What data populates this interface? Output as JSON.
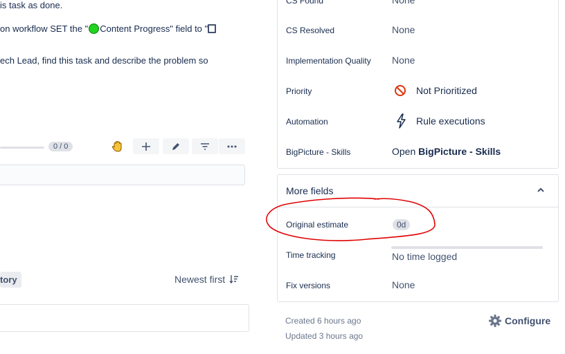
{
  "description": {
    "line1": "is task as done.",
    "line2_prefix": "on workflow SET the \"",
    "line2_suffix": "Content Progress\" field to \"",
    "line3": "ech Lead, find this task and describe the problem so"
  },
  "checklist": {
    "progress_label": "0 / 0",
    "progress_value": 0
  },
  "activity": {
    "history_tab": "tory",
    "sort_label": "Newest first"
  },
  "fields": [
    {
      "label": "CS Found",
      "value": "None"
    },
    {
      "label": "CS Resolved",
      "value": "None"
    },
    {
      "label": "Implementation Quality",
      "value": "None"
    },
    {
      "label": "Priority",
      "value": "Not Prioritized",
      "icon": "not-prioritized-icon"
    },
    {
      "label": "Automation",
      "value": "Rule executions",
      "icon": "lightning-icon"
    },
    {
      "label": "BigPicture - Skills",
      "value_prefix": "Open ",
      "value_strong": "BigPicture - Skills"
    }
  ],
  "more_fields": {
    "title": "More fields",
    "original_estimate_label": "Original estimate",
    "original_estimate_value": "0d",
    "time_tracking_label": "Time tracking",
    "time_tracking_value": "No time logged",
    "fix_versions_label": "Fix versions",
    "fix_versions_value": "None"
  },
  "footer": {
    "created": "Created 6 hours ago",
    "updated": "Updated 3 hours ago",
    "configure": "Configure"
  },
  "colors": {
    "accent": "#0052cc",
    "priority_icon": "#de350b",
    "annotation": "#e00000",
    "green_status": "#1fd31f"
  }
}
